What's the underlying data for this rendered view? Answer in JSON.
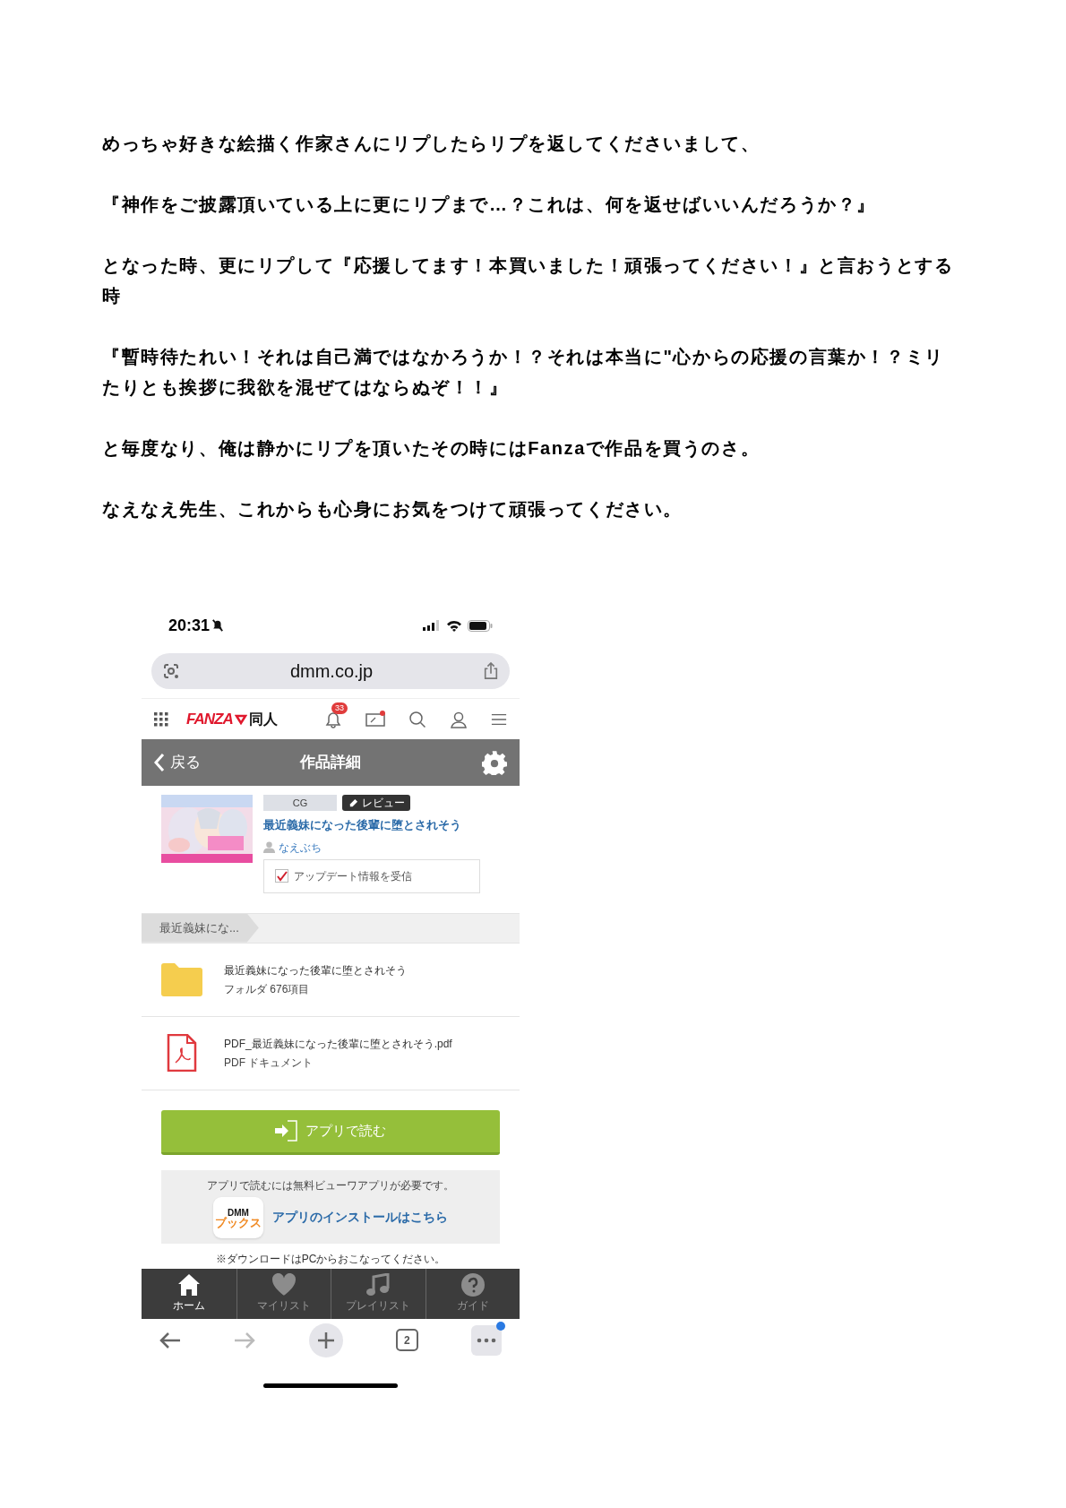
{
  "post": {
    "paragraphs": [
      "めっちゃ好きな絵描く作家さんにリプしたらリプを返してくださいまして、",
      "『神作をご披露頂いている上に更にリプまで…？これは、何を返せばいいんだろうか？』",
      "となった時、更にリプして『応援してます！本買いました！頑張ってください！』と言おうとする時",
      "『暫時待たれい！それは自己満ではなかろうか！？それは本当に\"心からの応援の言葉か！？ミリたりとも挨拶に我欲を混ぜてはならぬぞ！！』",
      "と毎度なり、俺は静かにリプを頂いたその時にはFanzaで作品を買うのさ。",
      "なえなえ先生、これからも心身にお気をつけて頑張ってください。"
    ]
  },
  "phone": {
    "status_bar": {
      "time": "20:31",
      "silent": true
    },
    "browser": {
      "url": "dmm.co.jp"
    },
    "site_nav": {
      "logo": "FANZA",
      "logo_suffix": "同人",
      "notification_count": "33",
      "coupon_dot": true
    },
    "header": {
      "back": "戻る",
      "title": "作品詳細"
    },
    "product": {
      "tags": [
        {
          "label": "CG",
          "kind": "category"
        },
        {
          "label": "レビュー",
          "kind": "review"
        }
      ],
      "title": "最近義妹になった後輩に堕とされそう",
      "author": "なえぶち",
      "update_option": {
        "label": "アップデート情報を受信",
        "checked": true
      }
    },
    "breadcrumb": "最近義妹にな...",
    "files": [
      {
        "kind": "folder",
        "name": "最近義妹になった後輩に堕とされそう",
        "detail": "フォルダ 676項目"
      },
      {
        "kind": "pdf",
        "name": "PDF_最近義妹になった後輩に堕とされそう.pdf",
        "detail": "PDF ドキュメント"
      }
    ],
    "read_button": "アプリで読む",
    "install": {
      "note": "アプリで読むには無料ビューワアプリが必要です。",
      "app_icon_top": "DMM",
      "app_icon_bottom": "ブックス",
      "link": "アプリのインストールはこちら"
    },
    "download_note": "※ダウンロードはPCからおこなってください。",
    "tab_bar": [
      {
        "label": "ホーム",
        "kind": "home",
        "selected": true
      },
      {
        "label": "マイリスト",
        "kind": "heart",
        "selected": false
      },
      {
        "label": "プレイリスト",
        "kind": "music",
        "selected": false
      },
      {
        "label": "ガイド",
        "kind": "guide",
        "selected": false
      }
    ],
    "toolbar": {
      "tab_count": "2",
      "menu_dot": true
    }
  }
}
